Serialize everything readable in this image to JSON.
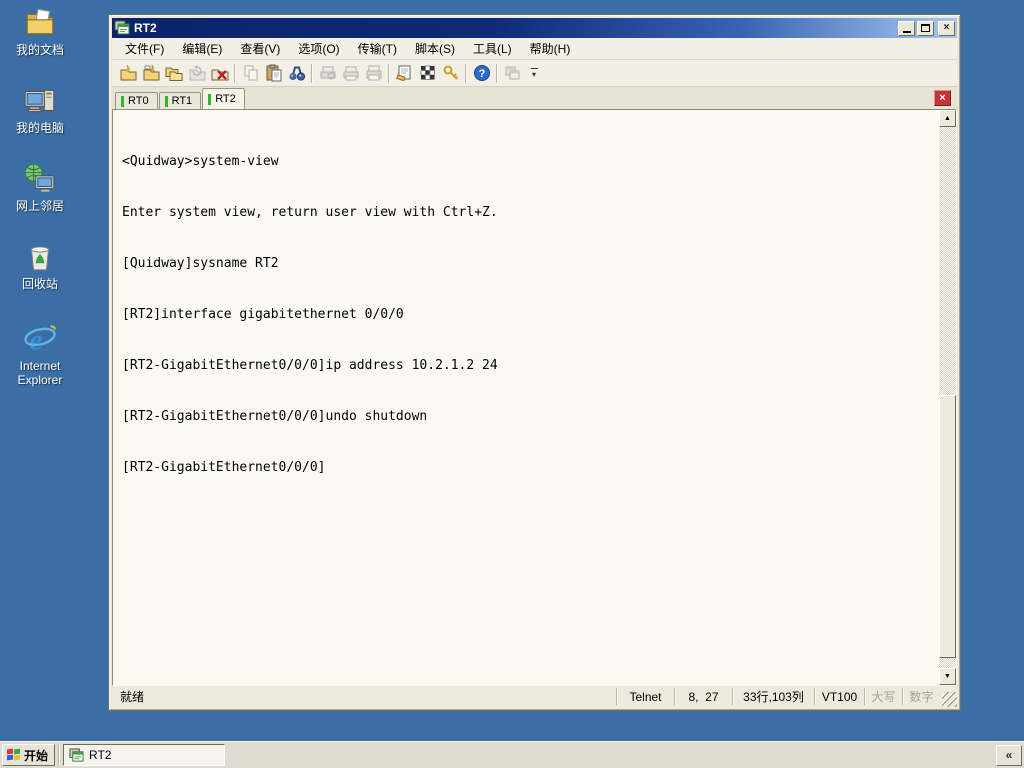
{
  "colors": {
    "desktop": "#3A6EA5",
    "title_gradient_start": "#0A246A",
    "title_gradient_end": "#A6CAF0",
    "tab_indicator_green": "#33B533",
    "tab_close_red": "#C13535",
    "terminal_bg": "#FBFAF2",
    "chrome": "#ECE9D8"
  },
  "desktop": {
    "icons": [
      {
        "name": "my-documents-icon",
        "label": "我的文档"
      },
      {
        "name": "my-computer-icon",
        "label": "我的电脑"
      },
      {
        "name": "network-places-icon",
        "label": "网上邻居"
      },
      {
        "name": "recycle-bin-icon",
        "label": "回收站"
      },
      {
        "name": "internet-explorer-icon",
        "label": "Internet Explorer"
      }
    ]
  },
  "window": {
    "title": "RT2",
    "controls": {
      "minimize": "minimize-icon",
      "maximize": "maximize-icon",
      "close_glyph": "×"
    },
    "menu": {
      "items": [
        "文件(F)",
        "编辑(E)",
        "查看(V)",
        "选项(O)",
        "传输(T)",
        "脚本(S)",
        "工具(L)",
        "帮助(H)"
      ]
    },
    "toolbar": {
      "icons": [
        {
          "name": "quick-connect-icon",
          "enabled": true
        },
        {
          "name": "connect-icon",
          "enabled": true
        },
        {
          "name": "connect-in-tab-icon",
          "enabled": true
        },
        {
          "name": "reconnect-icon",
          "enabled": false
        },
        {
          "name": "disconnect-icon",
          "enabled": true
        },
        {
          "name": "copy-icon",
          "enabled": false
        },
        {
          "name": "paste-icon",
          "enabled": true
        },
        {
          "name": "find-icon",
          "enabled": true
        },
        {
          "name": "print-preview-icon",
          "enabled": false
        },
        {
          "name": "print-setup-icon",
          "enabled": false
        },
        {
          "name": "print-icon",
          "enabled": false
        },
        {
          "name": "session-options-icon",
          "enabled": true
        },
        {
          "name": "global-options-icon",
          "enabled": true
        },
        {
          "name": "key-agent-icon",
          "enabled": true
        },
        {
          "name": "help-icon",
          "enabled": true
        },
        {
          "name": "session-manager-icon",
          "enabled": false
        }
      ]
    },
    "tabs": [
      {
        "label": "RT0",
        "active": false
      },
      {
        "label": "RT1",
        "active": false
      },
      {
        "label": "RT2",
        "active": true
      }
    ],
    "tab_close_glyph": "×",
    "terminal": {
      "lines": [
        "<Quidway>system-view",
        "Enter system view, return user view with Ctrl+Z.",
        "[Quidway]sysname RT2",
        "[RT2]interface gigabitethernet 0/0/0",
        "[RT2-GigabitEthernet0/0/0]ip address 10.2.1.2 24",
        "[RT2-GigabitEthernet0/0/0]undo shutdown",
        "[RT2-GigabitEthernet0/0/0]"
      ]
    },
    "scrollbar": {
      "up_glyph": "▲",
      "down_glyph": "▼"
    },
    "statusbar": {
      "ready": "就绪",
      "protocol": "Telnet",
      "cursor_pos": "8,  27",
      "screen_size": "33行,103列",
      "emulation": "VT100",
      "caps_lock": "大写",
      "num_lock": "数字"
    }
  },
  "taskbar": {
    "start_label": "开始",
    "tasks": [
      {
        "label": "RT2"
      }
    ],
    "overflow_glyph": "«"
  }
}
